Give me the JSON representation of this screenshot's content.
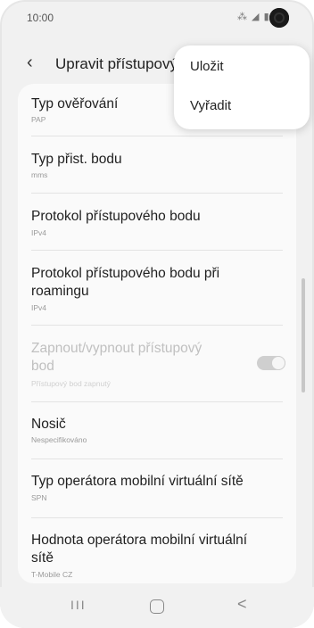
{
  "status_bar": {
    "time": "10:00",
    "icons": "⁂ ◢ ▮"
  },
  "header": {
    "back_icon": "‹",
    "title": "Upravit přístupový bod"
  },
  "items": [
    {
      "title": "Typ ověřování",
      "subtitle": "PAP"
    },
    {
      "title": "Typ přist. bodu",
      "subtitle": "mms"
    },
    {
      "title": "Protokol přístupového bodu",
      "subtitle": "IPv4"
    },
    {
      "title_line1": "Protokol přístupového bodu při",
      "title_line2": "roamingu",
      "subtitle": "IPv4"
    },
    {
      "title_line1": "Zapnout/vypnout přístupový",
      "title_line2": "bod",
      "subtitle": "Přístupový bod zapnutý",
      "enabled": false,
      "toggle_on": true
    },
    {
      "title": "Nosič",
      "subtitle": "Nespecifikováno"
    },
    {
      "title": "Typ operátora mobilní virtuální sítě",
      "subtitle": "SPN"
    },
    {
      "title_line1": "Hodnota operátora mobilní virtuální",
      "title_line2": "sítě",
      "subtitle": "T-Mobile CZ"
    }
  ],
  "menu": {
    "items": [
      "Uložit",
      "Vyřadit"
    ]
  },
  "nav_bar": {
    "recent": "III",
    "back": "<"
  },
  "colors": {
    "background": "#f1f1f1",
    "card": "#fafafa",
    "menu": "#ffffff",
    "text": "#1f1f1f",
    "subtext": "#9a9a9a"
  }
}
